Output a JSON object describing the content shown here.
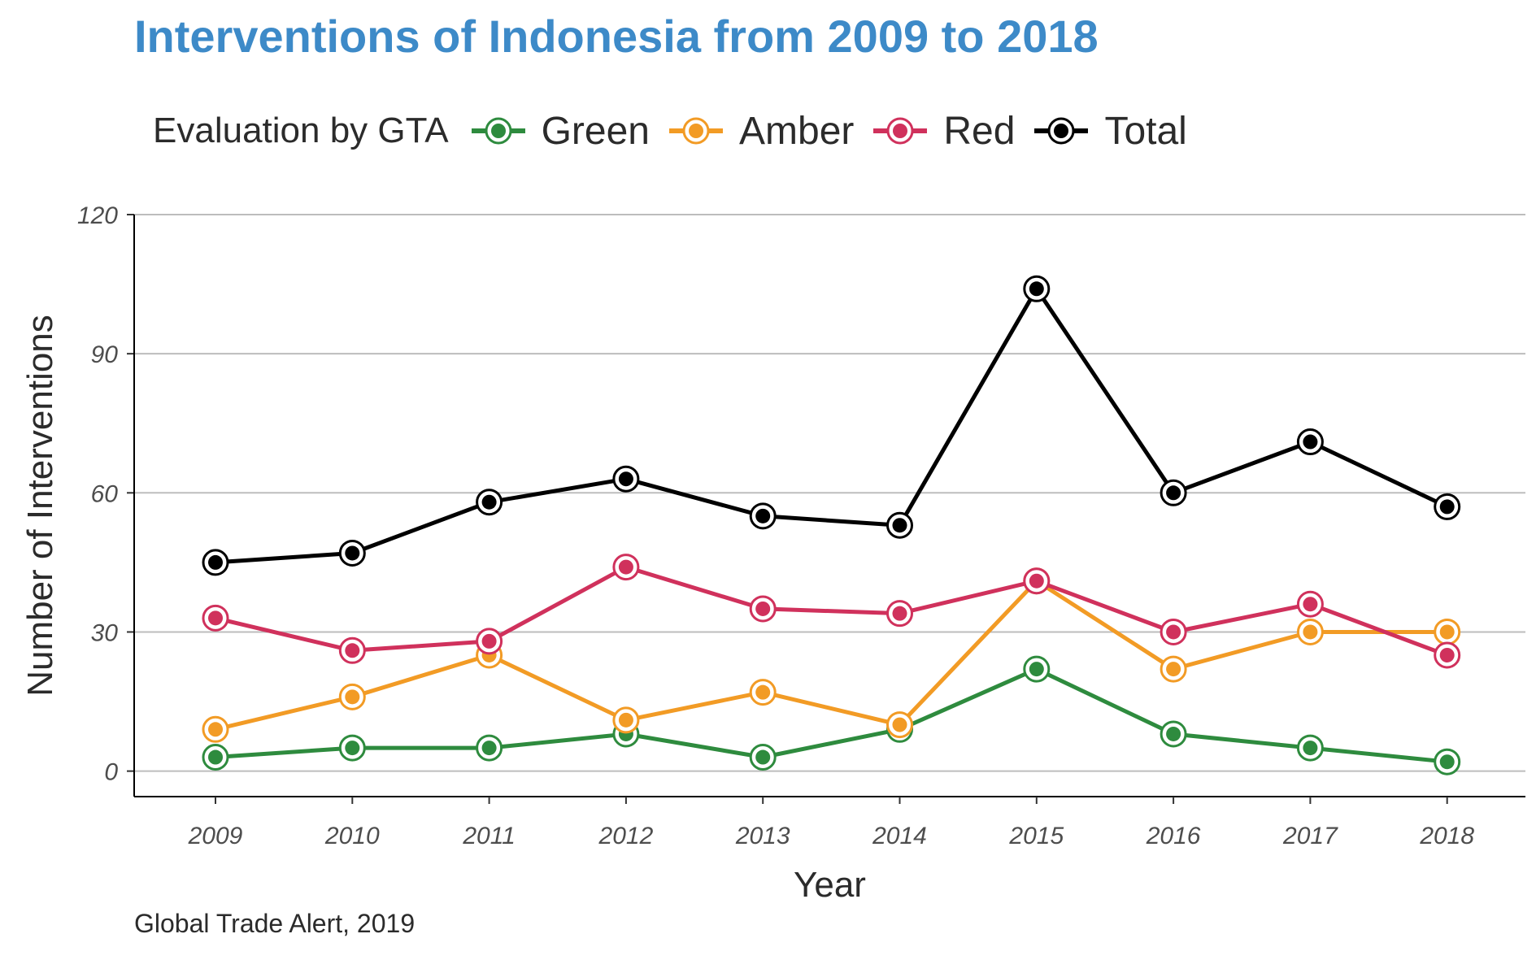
{
  "title": "Interventions of Indonesia from 2009 to 2018",
  "caption": "Global Trade Alert, 2019",
  "legend": {
    "title": "Evaluation by GTA",
    "items": [
      {
        "label": "Green",
        "color": "#2e8b3e"
      },
      {
        "label": "Amber",
        "color": "#f29b25"
      },
      {
        "label": "Red",
        "color": "#d0315c"
      },
      {
        "label": "Total",
        "color": "#000000"
      }
    ]
  },
  "chart_data": {
    "type": "line",
    "title": "Interventions of Indonesia from 2009 to 2018",
    "xlabel": "Year",
    "ylabel": "Number of Interventions",
    "x": [
      "2009",
      "2010",
      "2011",
      "2012",
      "2013",
      "2014",
      "2015",
      "2016",
      "2017",
      "2018"
    ],
    "ylim": [
      -5.5,
      120
    ],
    "yticks": [
      "0",
      "30",
      "60",
      "90",
      "120"
    ],
    "grid": "horizontal major lines",
    "legend_position": "top",
    "series": [
      {
        "name": "Green",
        "color": "#2e8b3e",
        "values": [
          3,
          5,
          5,
          8,
          3,
          9,
          22,
          8,
          5,
          2
        ]
      },
      {
        "name": "Amber",
        "color": "#f29b25",
        "values": [
          9,
          16,
          25,
          11,
          17,
          10,
          41,
          22,
          30,
          30
        ]
      },
      {
        "name": "Red",
        "color": "#d0315c",
        "values": [
          33,
          26,
          28,
          44,
          35,
          34,
          41,
          30,
          36,
          25
        ]
      },
      {
        "name": "Total",
        "color": "#000000",
        "values": [
          45,
          47,
          58,
          63,
          55,
          53,
          104,
          60,
          71,
          57
        ]
      }
    ]
  }
}
